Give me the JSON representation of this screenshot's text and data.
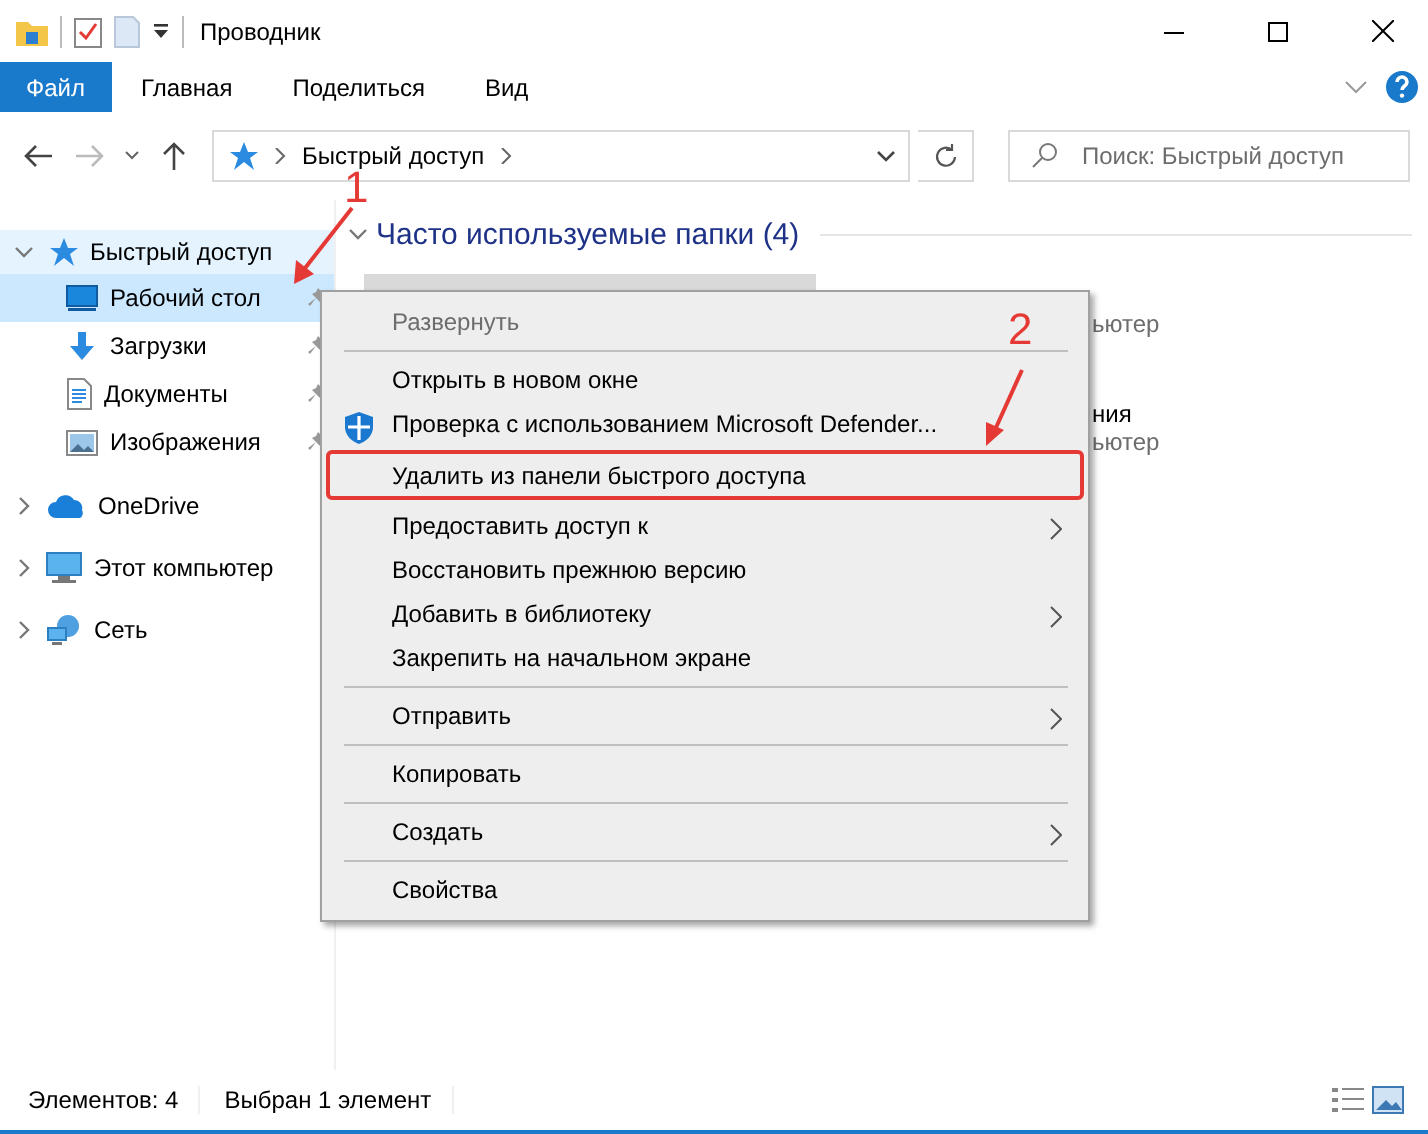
{
  "window": {
    "title": "Проводник"
  },
  "ribbon": {
    "tabs": [
      {
        "label": "Файл",
        "kind": "file"
      },
      {
        "label": "Главная",
        "kind": "tab"
      },
      {
        "label": "Поделиться",
        "kind": "tab"
      },
      {
        "label": "Вид",
        "kind": "tab"
      }
    ]
  },
  "address": {
    "path": "Быстрый доступ",
    "search_placeholder": "Поиск: Быстрый доступ"
  },
  "sidebar": {
    "items": [
      {
        "label": "Быстрый доступ",
        "kind": "star",
        "expanded": true,
        "selected": false,
        "children": [
          {
            "label": "Рабочий стол",
            "kind": "desktop",
            "selected": true
          },
          {
            "label": "Загрузки",
            "kind": "download",
            "selected": false
          },
          {
            "label": "Документы",
            "kind": "document",
            "selected": false
          },
          {
            "label": "Изображения",
            "kind": "image",
            "selected": false
          }
        ]
      },
      {
        "label": "OneDrive",
        "kind": "cloud",
        "expanded": false,
        "selected": false
      },
      {
        "label": "Этот компьютер",
        "kind": "computer",
        "expanded": false,
        "selected": false
      },
      {
        "label": "Сеть",
        "kind": "network",
        "expanded": false,
        "selected": false
      }
    ]
  },
  "content": {
    "group_title": "Часто используемые папки (4)",
    "expanded": true,
    "tiles": [
      {
        "selected": true
      },
      {
        "location": "ьютер",
        "selected": false
      },
      {
        "name": "ния",
        "location": "ьютер",
        "selected": false
      }
    ]
  },
  "context_menu": {
    "items": [
      {
        "kind": "item",
        "label": "Развернуть",
        "disabled": true
      },
      {
        "kind": "separator"
      },
      {
        "kind": "item",
        "label": "Открыть в новом окне"
      },
      {
        "kind": "scan",
        "label": "Проверка с использованием Microsoft Defender..."
      },
      {
        "kind": "item",
        "label": "Удалить из панели быстрого доступа",
        "highlighted": true
      },
      {
        "kind": "item",
        "label": "Предоставить доступ к",
        "submenu": true
      },
      {
        "kind": "item",
        "label": "Восстановить прежнюю версию"
      },
      {
        "kind": "item",
        "label": "Добавить в библиотеку",
        "submenu": true
      },
      {
        "kind": "item",
        "label": "Закрепить на начальном экране"
      },
      {
        "kind": "separator"
      },
      {
        "kind": "item",
        "label": "Отправить",
        "submenu": true
      },
      {
        "kind": "separator"
      },
      {
        "kind": "item",
        "label": "Копировать"
      },
      {
        "kind": "separator"
      },
      {
        "kind": "item",
        "label": "Создать",
        "submenu": true
      },
      {
        "kind": "separator"
      },
      {
        "kind": "item",
        "label": "Свойства"
      }
    ]
  },
  "annotations": [
    {
      "label": "1"
    },
    {
      "label": "2"
    }
  ],
  "status_bar": {
    "count": "Элементов: 4",
    "selection": "Выбран 1 элемент"
  }
}
